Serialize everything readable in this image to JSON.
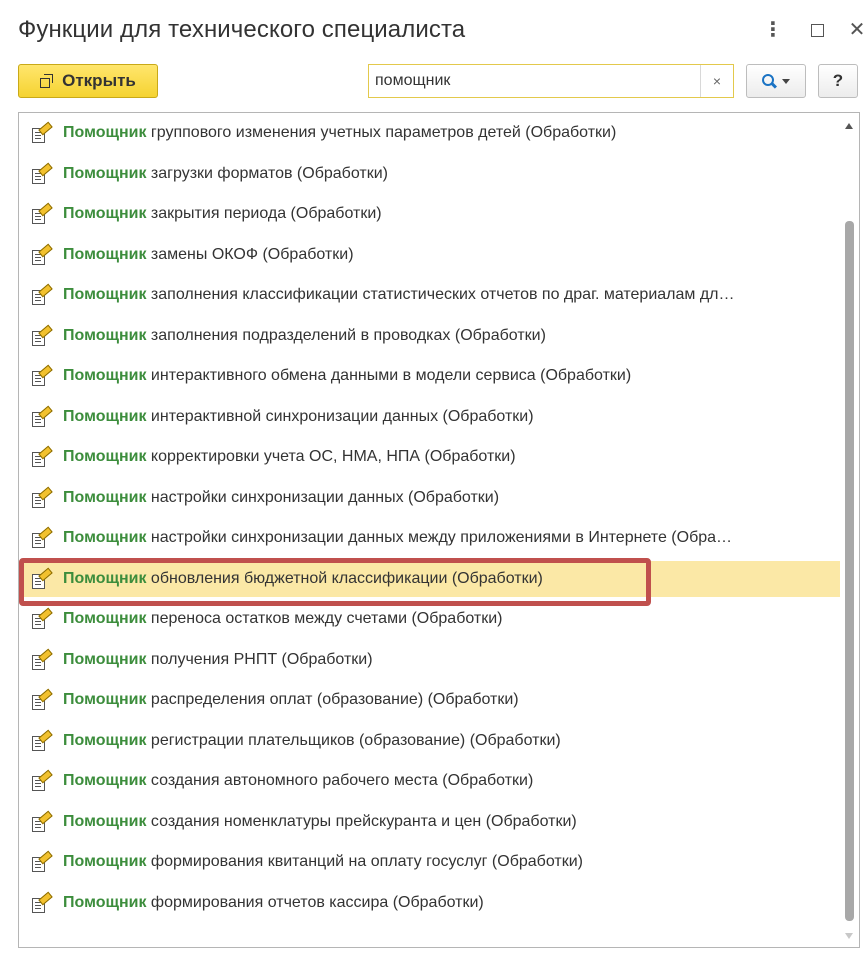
{
  "window": {
    "title": "Функции для технического специалиста",
    "more_glyph": "⋮",
    "close_glyph": "✕"
  },
  "toolbar": {
    "open_label": "Открыть",
    "search_value": "помощник",
    "clear_glyph": "×",
    "help_label": "?"
  },
  "list": {
    "highlight_word": "Помощник",
    "selected_index": 11,
    "items": [
      "группового изменения учетных параметров детей (Обработки)",
      "загрузки форматов (Обработки)",
      "закрытия периода (Обработки)",
      "замены ОКОФ (Обработки)",
      "заполнения классификации статистических отчетов по драг. материалам дл…",
      "заполнения подразделений в проводках (Обработки)",
      "интерактивного обмена данными в модели сервиса (Обработки)",
      "интерактивной синхронизации данных (Обработки)",
      "корректировки учета ОС, НМА, НПА (Обработки)",
      "настройки синхронизации данных (Обработки)",
      "настройки синхронизации данных между приложениями в Интернете (Обра…",
      "обновления бюджетной классификации (Обработки)",
      "переноса остатков между счетами (Обработки)",
      "получения РНПТ (Обработки)",
      "распределения оплат (образование) (Обработки)",
      "регистрации плательщиков (образование) (Обработки)",
      "создания автономного рабочего места (Обработки)",
      "создания номенклатуры прейскуранта и цен (Обработки)",
      "формирования квитанций на оплату госуслуг (Обработки)",
      "формирования отчетов кассира (Обработки)"
    ]
  },
  "colors": {
    "highlight_text": "#3c8d3c",
    "selected_row": "#fbe8a6",
    "annotation_border": "#c0504d",
    "primary_button": "#f5d331"
  },
  "icons": {
    "row": "processing-pencil-icon",
    "open": "open-window-icon",
    "search": "search-icon"
  }
}
